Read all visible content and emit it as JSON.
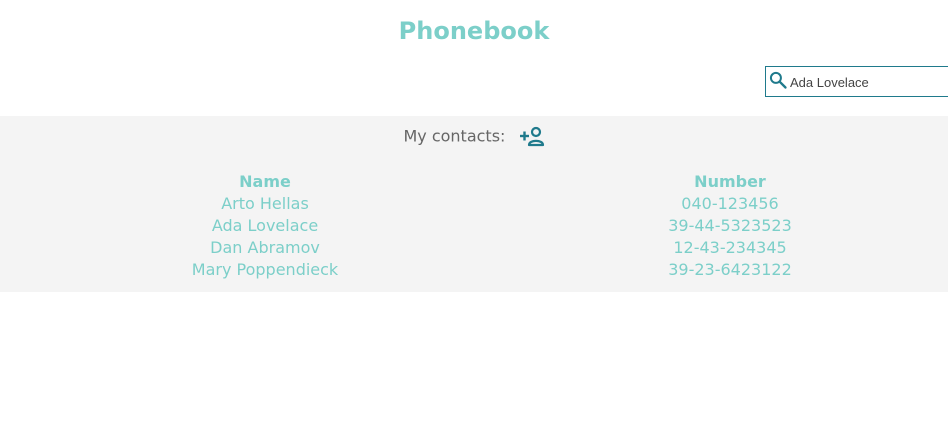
{
  "app": {
    "title": "Phonebook"
  },
  "search": {
    "value": "Ada Lovelace",
    "icon": "search-icon"
  },
  "contacts": {
    "header_label": "My contacts:",
    "add_icon": "person-add-icon",
    "columns": {
      "name": "Name",
      "number": "Number"
    },
    "rows": [
      {
        "name": "Arto Hellas",
        "number": "040-123456"
      },
      {
        "name": "Ada Lovelace",
        "number": "39-44-5323523"
      },
      {
        "name": "Dan Abramov",
        "number": "12-43-234345"
      },
      {
        "name": "Mary Poppendieck",
        "number": "39-23-6423122"
      }
    ]
  },
  "colors": {
    "accent": "#7ccfc9",
    "icon": "#1f7a8c",
    "panel_bg": "#f4f4f4"
  }
}
